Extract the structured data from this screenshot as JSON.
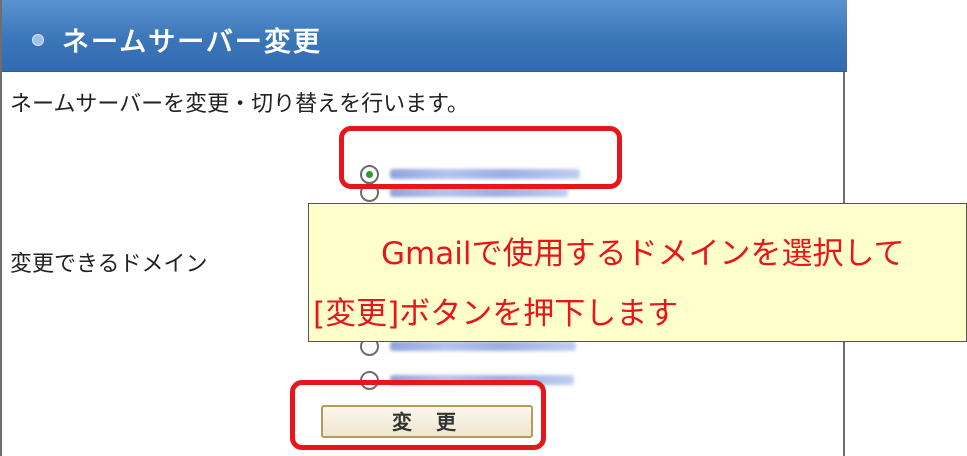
{
  "header": {
    "title": "ネームサーバー変更"
  },
  "intro_text": "ネームサーバーを変更・切り替えを行います。",
  "domain_label": "変更できるドメイン",
  "domain_options": [
    {
      "label": "",
      "selected": true
    },
    {
      "label": "",
      "selected": false
    },
    {
      "label": "",
      "selected": false
    },
    {
      "label": "",
      "selected": false
    }
  ],
  "callout": {
    "line1": "Gmailで使用するドメインを選択して",
    "line2": "[変更]ボタンを押下します"
  },
  "change_button": {
    "label": "変更"
  },
  "colors": {
    "header_blue": "#3b76b9",
    "highlight_red": "#e8151b",
    "callout_bg": "#ffffcc",
    "radio_selected": "#2f9b2f"
  }
}
